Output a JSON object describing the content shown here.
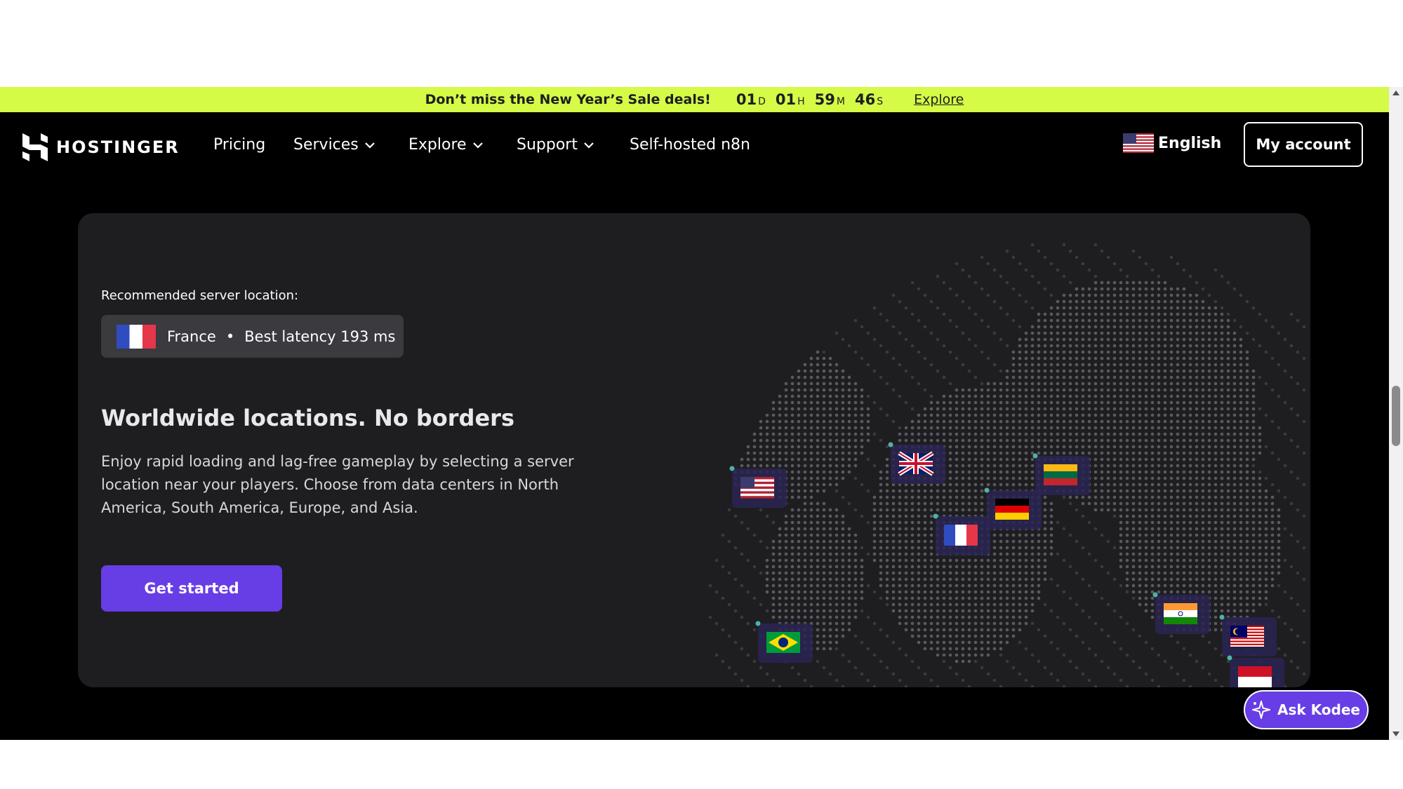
{
  "promo": {
    "text": "Don’t miss the New Year’s Sale deals!",
    "countdown": [
      {
        "value": "01",
        "unit": "D"
      },
      {
        "value": "01",
        "unit": "H"
      },
      {
        "value": "59",
        "unit": "M"
      },
      {
        "value": "46",
        "unit": "S"
      }
    ],
    "link": "Explore"
  },
  "nav": {
    "logo": "HOSTINGER",
    "items": [
      "Pricing",
      "Services",
      "Explore",
      "Support",
      "Self-hosted n8n"
    ],
    "language": "English",
    "account": "My account"
  },
  "hero": {
    "recommended_label": "Recommended server location:",
    "location": "France",
    "separator": "•",
    "latency": "Best latency 193 ms",
    "heading": "Worldwide locations. No borders",
    "description": "Enjoy rapid loading and lag-free gameplay by selecting a server location near your players. Choose from data centers in North America, South America, Europe, and Asia.",
    "cta": "Get started"
  },
  "map_flags": [
    "united-states",
    "united-kingdom",
    "lithuania",
    "germany",
    "france",
    "brazil",
    "india",
    "malaysia",
    "indonesia"
  ],
  "assistant": {
    "label": "Ask Kodee"
  },
  "colors": {
    "promo_bg": "#d5fb47",
    "brand_purple": "#673de6",
    "card_bg": "#1e1e21"
  }
}
